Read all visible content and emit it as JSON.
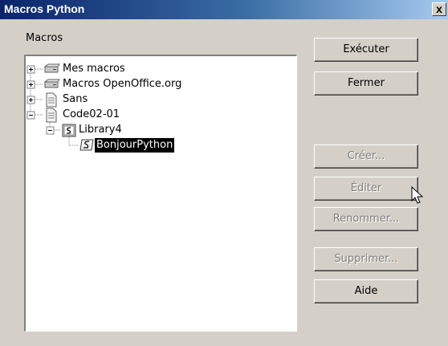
{
  "window": {
    "title": "Macros Python",
    "close_glyph": "x"
  },
  "section_label": "Macros",
  "tree": {
    "nodes": [
      {
        "label": "Mes macros",
        "icon": "drive-icon",
        "expander": "+"
      },
      {
        "label": "Macros OpenOffice.org",
        "icon": "drive-icon",
        "expander": "+"
      },
      {
        "label": "Sans",
        "icon": "document-icon",
        "expander": "+"
      },
      {
        "label": "Code02-01",
        "icon": "document-icon",
        "expander": "-"
      },
      {
        "label": "Library4",
        "icon": "library-icon",
        "expander": "-"
      },
      {
        "label": "BonjourPython",
        "icon": "script-icon",
        "selected": true
      }
    ]
  },
  "buttons": {
    "run": {
      "label": "Exécuter",
      "enabled": true
    },
    "close": {
      "label": "Fermer",
      "enabled": true
    },
    "create": {
      "label": "Créer...",
      "enabled": false
    },
    "edit": {
      "label": "Éditer",
      "enabled": false
    },
    "rename": {
      "label": "Renommer...",
      "enabled": false
    },
    "delete": {
      "label": "Supprimer...",
      "enabled": false
    },
    "help": {
      "label": "Aide",
      "enabled": true
    }
  },
  "colors": {
    "title_bar_start": "#0a246a",
    "title_bar_end": "#a6caf0",
    "dialog_bg": "#d4d0c8",
    "selection_bg": "#000000"
  }
}
